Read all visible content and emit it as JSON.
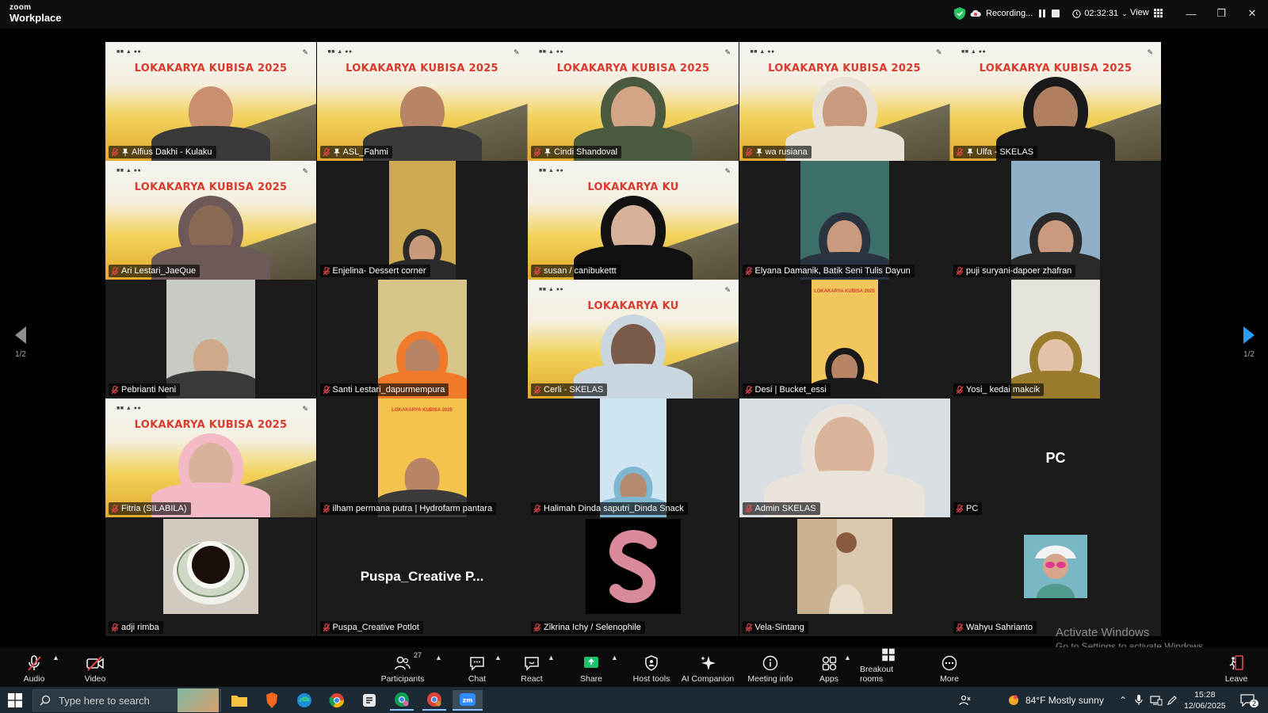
{
  "app": {
    "logo_line1": "zoom",
    "logo_line2": "Workplace"
  },
  "topbar": {
    "recording_label": "Recording...",
    "timer": "02:32:31",
    "view_label": "View"
  },
  "pagination": {
    "left": "1/2",
    "right": "1/2"
  },
  "banner_text": "LOKAKARYA KUBISA 2025",
  "banner_partial": "LOKAKARYA KU",
  "banner_small": "LOKAKARYA KUBISA 2025",
  "participants_tiles": [
    {
      "name": "Alfius Dakhi - Kulaku"
    },
    {
      "name": "ASL_Fahmi"
    },
    {
      "name": "Cindi Shandoval"
    },
    {
      "name": "wa rusiana"
    },
    {
      "name": "Ulfa - SKELAS"
    },
    {
      "name": "Ari Lestari_JaeQue"
    },
    {
      "name": "Enjelina- Dessert corner"
    },
    {
      "name": "susan / canibukettt"
    },
    {
      "name": "Elyana Damanik, Batik Seni Tulis Dayun"
    },
    {
      "name": "puji suryani-dapoer zhafran"
    },
    {
      "name": "Pebrianti Neni"
    },
    {
      "name": "Santi Lestari_dapurmempura"
    },
    {
      "name": "Cerli - SKELAS"
    },
    {
      "name": "Desi | Bucket_essi"
    },
    {
      "name": "Yosi_ kedai makcik"
    },
    {
      "name": "Fitria (SILABILA)"
    },
    {
      "name": "ilham permana putra | Hydrofarm pantara"
    },
    {
      "name": "Halimah Dinda saputri_Dinda Snack"
    },
    {
      "name": "Admin SKELAS"
    },
    {
      "name": "PC",
      "avatar_text": "PC"
    },
    {
      "name": "adji rimba"
    },
    {
      "name": "Puspa_Creative Potlot",
      "avatar_text": "Puspa_Creative P..."
    },
    {
      "name": "Zikrina Ichy / Selenophile"
    },
    {
      "name": "Vela-Sintang"
    },
    {
      "name": "Wahyu Sahrianto"
    }
  ],
  "windows_notice": {
    "line1": "Activate Windows",
    "line2": "Go to Settings to activate Windows."
  },
  "toolbar": {
    "audio": "Audio",
    "video": "Video",
    "participants": "Participants",
    "participants_count": "27",
    "chat": "Chat",
    "react": "React",
    "share": "Share",
    "host_tools": "Host tools",
    "ai_companion": "AI Companion",
    "meeting_info": "Meeting info",
    "apps": "Apps",
    "breakout_rooms": "Breakout rooms",
    "more": "More",
    "leave": "Leave"
  },
  "taskbar": {
    "search_placeholder": "Type here to search",
    "weather": "84°F  Mostly sunny",
    "time": "15:28",
    "date": "12/06/2025",
    "notifications": "2"
  },
  "colors": {
    "active_speaker": "#19d48a",
    "share_green": "#1fc16b",
    "muted_red": "#e5484d",
    "next_arrow": "#2d9bf0"
  }
}
